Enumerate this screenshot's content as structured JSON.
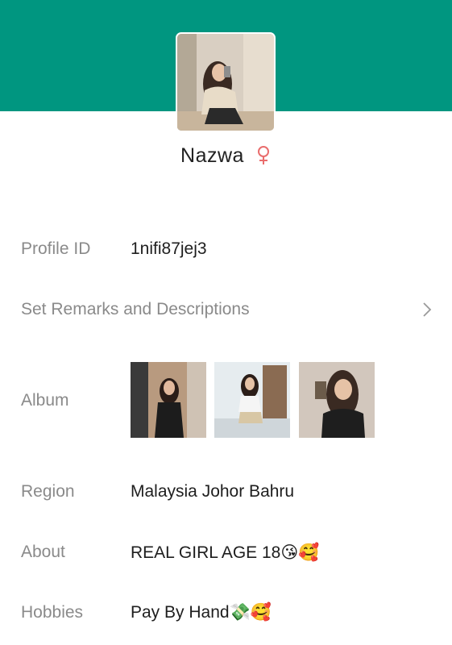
{
  "profile": {
    "name": "Nazwa",
    "gender_icon": "female-symbol-icon",
    "gender_color": "#e96d6d",
    "header_color": "#009680"
  },
  "fields": {
    "profile_id": {
      "label": "Profile ID",
      "value": "1nifi87jej3"
    },
    "remarks": {
      "label": "Set Remarks and Descriptions",
      "icon": "chevron-right-icon"
    },
    "album": {
      "label": "Album",
      "photo_count": 3
    },
    "region": {
      "label": "Region",
      "value": "Malaysia Johor Bahru"
    },
    "about": {
      "label": "About",
      "value": "REAL GIRL AGE 18😘🥰"
    },
    "hobbies": {
      "label": "Hobbies",
      "value": "Pay By Hand💸🥰"
    }
  }
}
